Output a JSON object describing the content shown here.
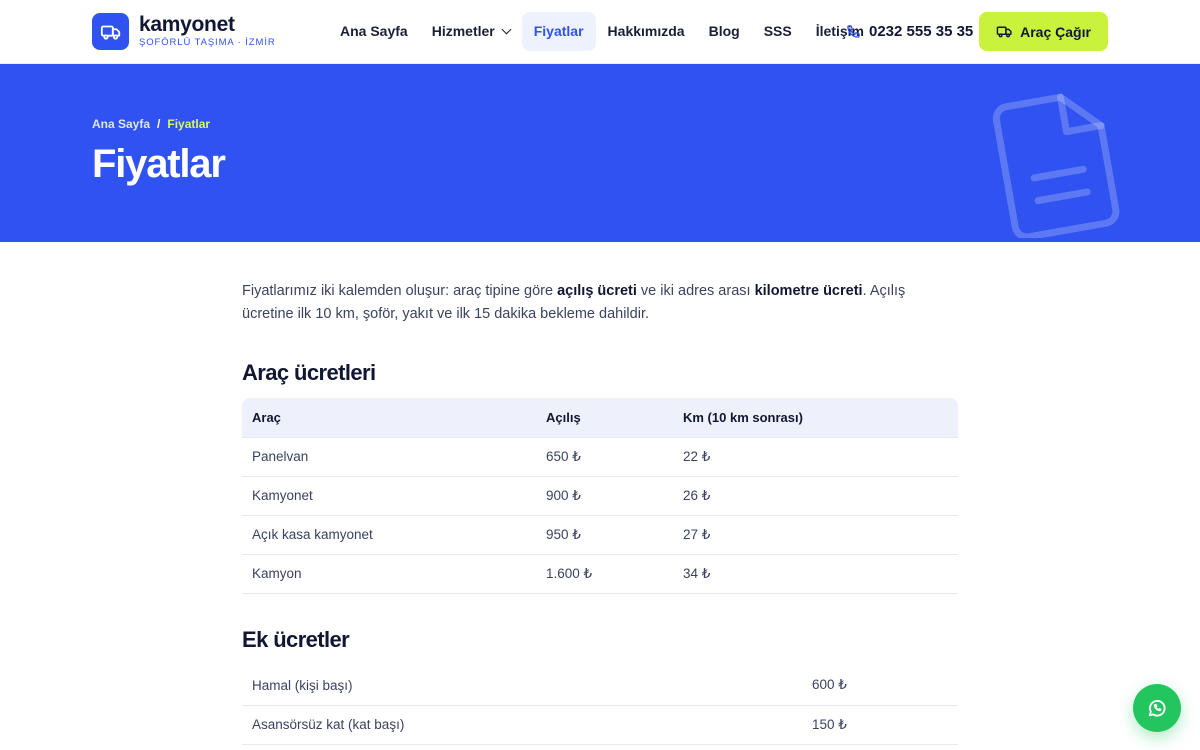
{
  "brand": {
    "name": "kamyonet",
    "tagline": "ŞOFÖRLÜ TAŞIMA · İZMİR"
  },
  "nav": {
    "items": [
      {
        "label": "Ana Sayfa"
      },
      {
        "label": "Hizmetler"
      },
      {
        "label": "Fiyatlar"
      },
      {
        "label": "Hakkımızda"
      },
      {
        "label": "Blog"
      },
      {
        "label": "SSS"
      },
      {
        "label": "İletişim"
      }
    ],
    "active": "Fiyatlar"
  },
  "header": {
    "phone": "0232 555 35 35",
    "cta_label": "Araç Çağır"
  },
  "hero": {
    "breadcrumb": {
      "home": "Ana Sayfa",
      "separator": "/",
      "current": "Fiyatlar"
    },
    "title": "Fiyatlar"
  },
  "intro": {
    "p1": "Fiyatlarımız iki kalemden oluşur: araç tipine göre ",
    "b1": "açılış ücreti",
    "p2": " ve iki adres arası ",
    "b2": "kilometre ücreti",
    "p3": ". Açılış ücretine ilk 10 km, şoför, yakıt ve ilk 15 dakika bekleme dahildir."
  },
  "vehicle_prices": {
    "title": "Araç ücretleri",
    "headers": [
      "Araç",
      "Açılış",
      "Km (10 km sonrası)"
    ],
    "rows": [
      [
        "Panelvan",
        "650 ₺",
        "22 ₺"
      ],
      [
        "Kamyonet",
        "900 ₺",
        "26 ₺"
      ],
      [
        "Açık kasa kamyonet",
        "950 ₺",
        "27 ₺"
      ],
      [
        "Kamyon",
        "1.600 ₺",
        "34 ₺"
      ]
    ]
  },
  "extra_fees": {
    "title": "Ek ücretler",
    "rows": [
      [
        "Hamal (kişi başı)",
        "600 ₺"
      ],
      [
        "Asansörsüz kat (kat başı)",
        "150 ₺"
      ]
    ]
  },
  "colors": {
    "primary": "#2f52f0",
    "accent": "#c9f23d",
    "whatsapp": "#22c55e"
  },
  "icons": {
    "logo": "truck-icon",
    "phone": "phone-icon",
    "cta": "truck-icon",
    "hero": "document-icon",
    "float": "whatsapp-icon"
  }
}
